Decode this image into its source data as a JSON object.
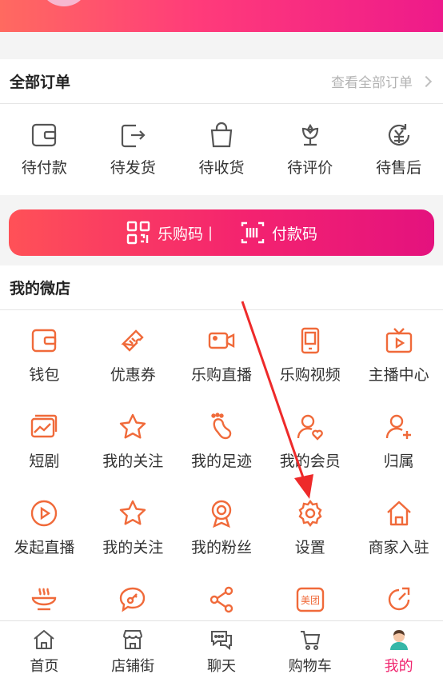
{
  "orders": {
    "title": "全部订单",
    "view_all": "查看全部订单",
    "items": [
      {
        "label": "待付款",
        "icon": "wallet-icon"
      },
      {
        "label": "待发货",
        "icon": "ship-icon"
      },
      {
        "label": "待收货",
        "icon": "bag-icon"
      },
      {
        "label": "待评价",
        "icon": "flower-icon"
      },
      {
        "label": "待售后",
        "icon": "refund-icon"
      }
    ]
  },
  "codes": {
    "legou_code": "乐购码",
    "separator": "|",
    "pay_code": "付款码"
  },
  "shop": {
    "title": "我的微店",
    "items": [
      {
        "label": "钱包",
        "icon": "wallet-icon"
      },
      {
        "label": "优惠券",
        "icon": "ticket-icon"
      },
      {
        "label": "乐购直播",
        "icon": "camera-icon"
      },
      {
        "label": "乐购视频",
        "icon": "phone-icon"
      },
      {
        "label": "主播中心",
        "icon": "tv-icon"
      },
      {
        "label": "短剧",
        "icon": "picture-icon"
      },
      {
        "label": "我的关注",
        "icon": "star-icon"
      },
      {
        "label": "我的足迹",
        "icon": "footprint-icon"
      },
      {
        "label": "我的会员",
        "icon": "member-icon"
      },
      {
        "label": "归属",
        "icon": "user-add-icon"
      },
      {
        "label": "发起直播",
        "icon": "play-icon"
      },
      {
        "label": "我的关注",
        "icon": "star-icon"
      },
      {
        "label": "我的粉丝",
        "icon": "badge-icon"
      },
      {
        "label": "设置",
        "icon": "gear-icon"
      },
      {
        "label": "商家入驻",
        "icon": "home-icon"
      },
      {
        "label": "",
        "icon": "bowl-icon"
      },
      {
        "label": "",
        "icon": "chat-key-icon"
      },
      {
        "label": "",
        "icon": "share-icon"
      },
      {
        "label": "",
        "icon": "meituan-icon",
        "icon_text": "美团"
      },
      {
        "label": "",
        "icon": "timer-icon"
      }
    ]
  },
  "tabs": [
    {
      "label": "首页",
      "icon": "home-icon"
    },
    {
      "label": "店铺街",
      "icon": "store-icon"
    },
    {
      "label": "聊天",
      "icon": "chat-icon"
    },
    {
      "label": "购物车",
      "icon": "cart-icon"
    },
    {
      "label": "我的",
      "icon": "profile-icon",
      "active": true
    }
  ],
  "colors": {
    "accent": "#f0266f",
    "icon_orange": "#f06a3a",
    "arrow": "#ee2a2a"
  }
}
